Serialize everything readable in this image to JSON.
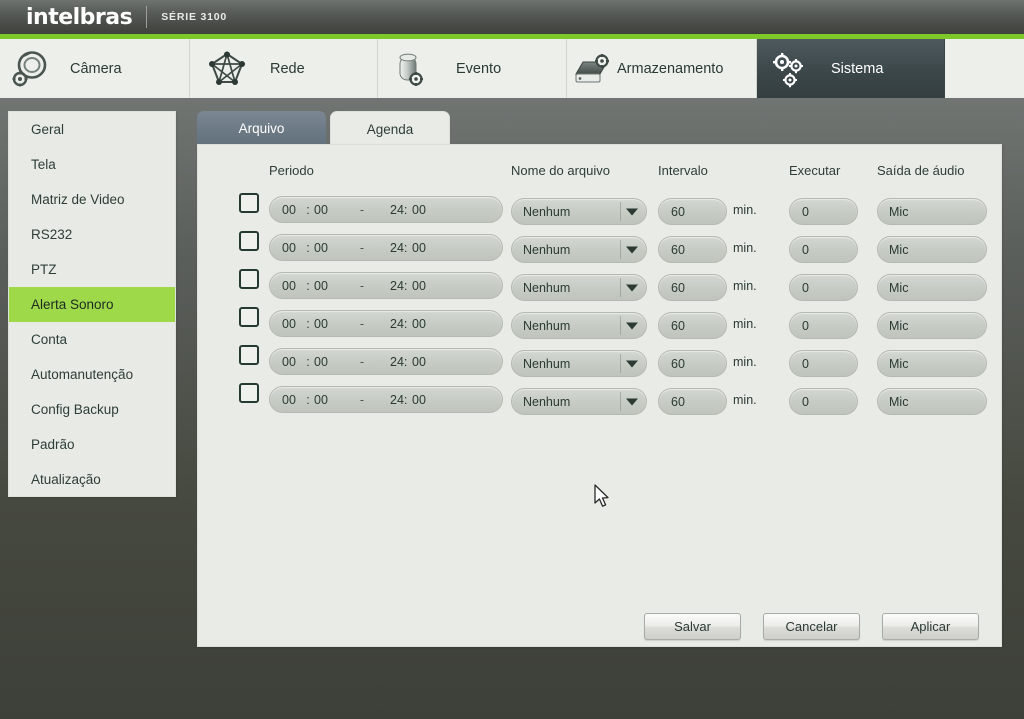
{
  "titlebar": {
    "brand": "intelbras",
    "series": "SÉRIE 3100"
  },
  "nav": {
    "items": [
      {
        "label": "Câmera",
        "icon": "camera-gear-icon",
        "active": false
      },
      {
        "label": "Rede",
        "icon": "network-icon",
        "active": false
      },
      {
        "label": "Evento",
        "icon": "event-gear-icon",
        "active": false
      },
      {
        "label": "Armazenamento",
        "icon": "hdd-gear-icon",
        "active": false
      },
      {
        "label": "Sistema",
        "icon": "gears-icon",
        "active": true
      }
    ]
  },
  "sidebar": {
    "items": [
      {
        "label": "Geral",
        "active": false
      },
      {
        "label": "Tela",
        "active": false
      },
      {
        "label": "Matriz de Video",
        "active": false
      },
      {
        "label": "RS232",
        "active": false
      },
      {
        "label": "PTZ",
        "active": false
      },
      {
        "label": "Alerta Sonoro",
        "active": true
      },
      {
        "label": "Conta",
        "active": false
      },
      {
        "label": "Automanutenção",
        "active": false
      },
      {
        "label": "Config Backup",
        "active": false
      },
      {
        "label": "Padrão",
        "active": false
      },
      {
        "label": "Atualização",
        "active": false
      }
    ],
    "active_color": "#9ed94a"
  },
  "tabs": [
    {
      "label": "Arquivo",
      "active": false
    },
    {
      "label": "Agenda",
      "active": true
    }
  ],
  "table": {
    "headers": {
      "periodo": "Periodo",
      "nome": "Nome do arquivo",
      "intervalo": "Intervalo",
      "executar": "Executar",
      "saida": "Saída de áudio"
    },
    "unit_label": "min.",
    "rows": [
      {
        "enabled": false,
        "start_hour": "00",
        "start_min": "00",
        "sep": "-",
        "end_hour": "24:",
        "end_min": "00",
        "file": "Nenhum",
        "interval": "60",
        "execute": "0",
        "audio": "Mic"
      },
      {
        "enabled": false,
        "start_hour": "00",
        "start_min": "00",
        "sep": "-",
        "end_hour": "24:",
        "end_min": "00",
        "file": "Nenhum",
        "interval": "60",
        "execute": "0",
        "audio": "Mic"
      },
      {
        "enabled": false,
        "start_hour": "00",
        "start_min": "00",
        "sep": "-",
        "end_hour": "24:",
        "end_min": "00",
        "file": "Nenhum",
        "interval": "60",
        "execute": "0",
        "audio": "Mic"
      },
      {
        "enabled": false,
        "start_hour": "00",
        "start_min": "00",
        "sep": "-",
        "end_hour": "24:",
        "end_min": "00",
        "file": "Nenhum",
        "interval": "60",
        "execute": "0",
        "audio": "Mic"
      },
      {
        "enabled": false,
        "start_hour": "00",
        "start_min": "00",
        "sep": "-",
        "end_hour": "24:",
        "end_min": "00",
        "file": "Nenhum",
        "interval": "60",
        "execute": "0",
        "audio": "Mic"
      },
      {
        "enabled": false,
        "start_hour": "00",
        "start_min": "00",
        "sep": "-",
        "end_hour": "24:",
        "end_min": "00",
        "file": "Nenhum",
        "interval": "60",
        "execute": "0",
        "audio": "Mic"
      }
    ]
  },
  "buttons": {
    "save": "Salvar",
    "cancel": "Cancelar",
    "apply": "Aplicar"
  },
  "colors": {
    "accent_green": "#7dc728",
    "highlight_green": "#9ed94a",
    "panel": "#e9ece6",
    "nav_active": "#3c474a"
  }
}
